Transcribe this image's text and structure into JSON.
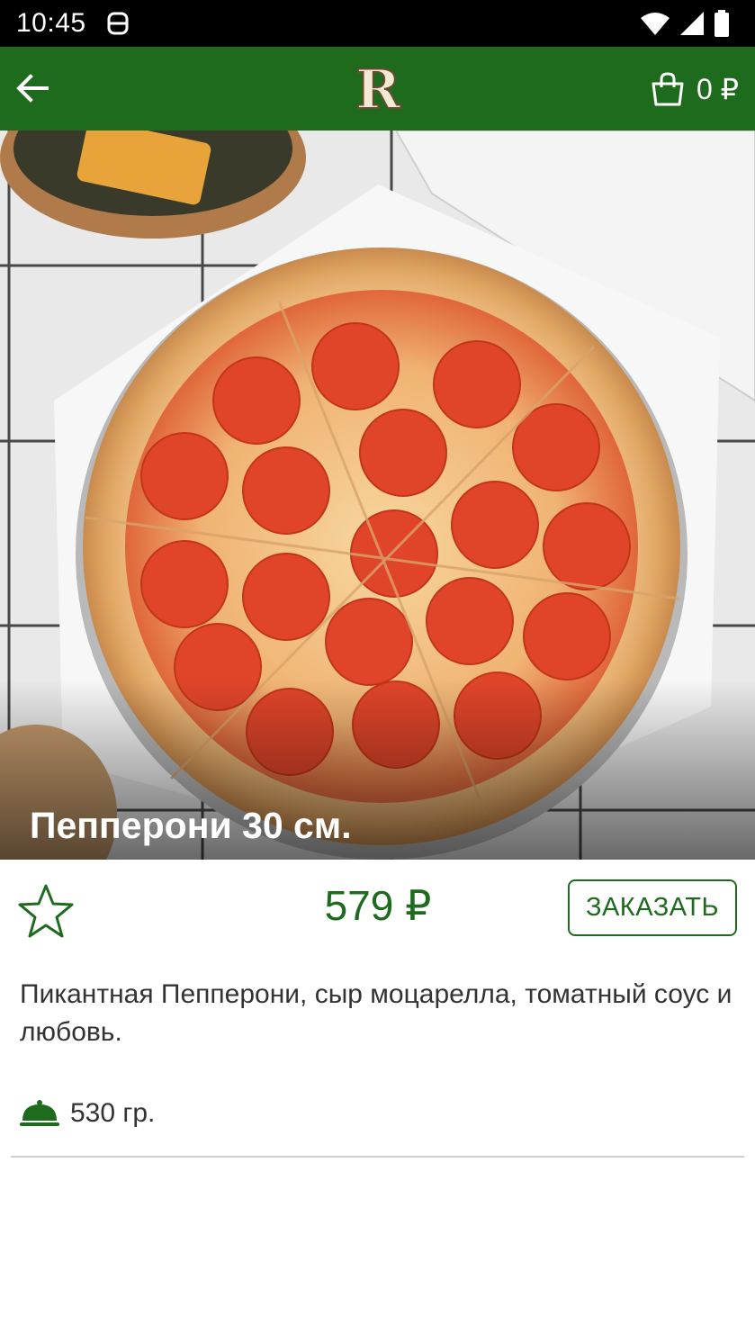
{
  "status_bar": {
    "time": "10:45",
    "icons": [
      "app-notification-icon",
      "wifi-icon",
      "signal-icon",
      "battery-icon"
    ]
  },
  "app_bar": {
    "back_icon": "arrow-left-icon",
    "logo_letter": "R",
    "cart_icon": "shopping-bag-icon",
    "cart_amount": "0 ₽"
  },
  "product": {
    "title": "Пепперони 30 см.",
    "price": "579 ₽",
    "order_label": "ЗАКАЗАТЬ",
    "description": "Пикантная Пепперони, сыр моцарелла, томатный соус и любовь.",
    "weight": "530 гр.",
    "favorite_icon": "star-outline-icon",
    "weight_icon": "cloche-icon"
  },
  "colors": {
    "brand_green": "#1e6b1e",
    "status_bar": "#000000",
    "text": "#333333"
  }
}
